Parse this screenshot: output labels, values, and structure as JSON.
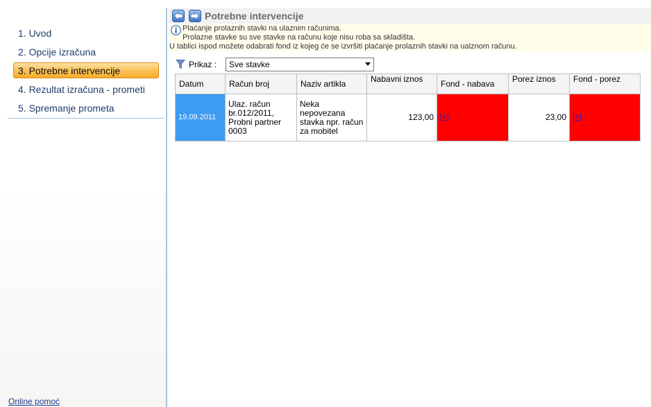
{
  "sidebar": {
    "steps": [
      {
        "label": "1. Uvod",
        "active": false
      },
      {
        "label": "2. Opcije izračuna",
        "active": false
      },
      {
        "label": "3. Potrebne intervencije",
        "active": true
      },
      {
        "label": "4. Rezultat izračuna - prometi",
        "active": false
      },
      {
        "label": "5. Spremanje prometa",
        "active": false
      }
    ],
    "online_help": "Online pomoć"
  },
  "header": {
    "title": "Potrebne intervencije",
    "back_icon": "arrow-left-icon",
    "forward_icon": "arrow-right-icon"
  },
  "info": {
    "icon": "info-icon",
    "line1": "Plaćanje prolaznih stavki na ulaznim računima.",
    "line2": "Prolazne stavke su sve stavke na računu koje nisu roba sa skladišta.",
    "line3": "U tablici ispod možete odabrati fond iz kojeg će se izvršiti plaćanje prolaznih stavki na ualznom računu."
  },
  "filter": {
    "icon": "funnel-icon",
    "label": "Prikaz :",
    "selected": "Sve stavke"
  },
  "table": {
    "headers": [
      "Datum",
      "Račun broj",
      "Naziv artikla",
      "Nabavni iznos",
      "Fond - nabava",
      "Porez iznos",
      "Fond - porez"
    ],
    "rows": [
      {
        "datum": "19.09.2011",
        "racun_broj": "Ulaz. račun br.012/2011, Probni partner 0003",
        "naziv_artikla": "Neka nepovezana stavka npr. račun za mobitel",
        "nabavni_iznos": "123,00",
        "fond_nabava": "[+]",
        "porez_iznos": "23,00",
        "fond_porez": "[+]"
      }
    ]
  },
  "colors": {
    "active_step": "#fbc25a",
    "date_cell": "#3d9bf2",
    "fund_cell": "#ff0000",
    "link": "#1020e0"
  }
}
